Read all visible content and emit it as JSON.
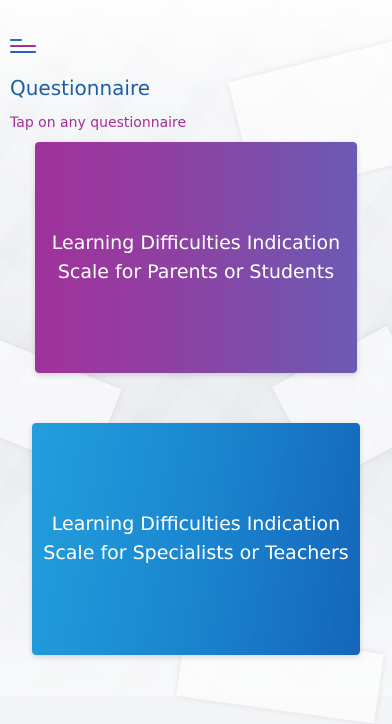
{
  "header": {
    "menu_icon": "hamburger-menu-icon"
  },
  "page": {
    "title": "Questionnaire",
    "subtitle": "Tap on any questionnaire"
  },
  "questionnaires": [
    {
      "line1": "Learning Difficulties Indication",
      "line2": "Scale for Parents or Students"
    },
    {
      "line1": "Learning Difficulties Indication",
      "line2": "Scale for Specialists or Teachers"
    }
  ],
  "colors": {
    "title": "#1e5fa3",
    "subtitle": "#a12f9a",
    "card1_start": "#a1319b",
    "card1_end": "#6b5ab4",
    "card2_start": "#239fdc",
    "card2_end": "#1565ba"
  }
}
